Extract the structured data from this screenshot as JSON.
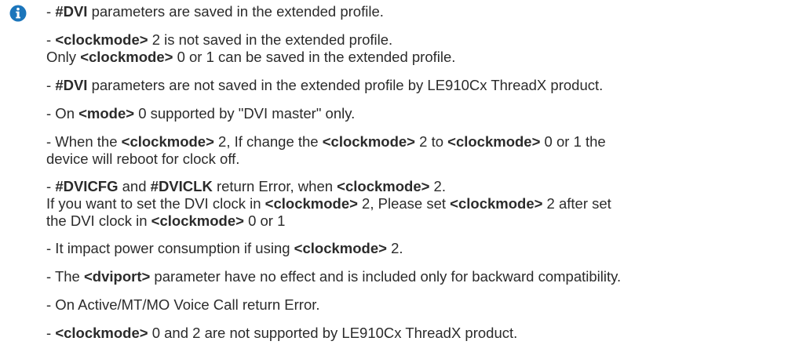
{
  "icon": {
    "name": "info-icon",
    "color": "#1b75bb"
  },
  "notes": [
    {
      "lines": [
        [
          {
            "t": "- "
          },
          {
            "t": "#DVI",
            "b": true
          },
          {
            "t": " parameters are saved in the extended profile."
          }
        ]
      ]
    },
    {
      "lines": [
        [
          {
            "t": "- "
          },
          {
            "t": "<clockmode>",
            "b": true
          },
          {
            "t": " 2 is not saved in the extended profile."
          }
        ],
        [
          {
            "t": "Only "
          },
          {
            "t": "<clockmode>",
            "b": true
          },
          {
            "t": " 0 or 1 can be saved in the extended profile."
          }
        ]
      ]
    },
    {
      "lines": [
        [
          {
            "t": "- "
          },
          {
            "t": "#DVI",
            "b": true
          },
          {
            "t": " parameters are not saved in the extended profile by LE910Cx ThreadX product."
          }
        ]
      ]
    },
    {
      "lines": [
        [
          {
            "t": "- On "
          },
          {
            "t": "<mode>",
            "b": true
          },
          {
            "t": " 0 supported by \"DVI master\" only."
          }
        ]
      ]
    },
    {
      "lines": [
        [
          {
            "t": "- When the "
          },
          {
            "t": "<clockmode>",
            "b": true
          },
          {
            "t": " 2, If change the "
          },
          {
            "t": "<clockmode>",
            "b": true
          },
          {
            "t": " 2 to "
          },
          {
            "t": "<clockmode>",
            "b": true
          },
          {
            "t": " 0 or 1 the"
          }
        ],
        [
          {
            "t": "device will reboot for clock off."
          }
        ]
      ]
    },
    {
      "lines": [
        [
          {
            "t": "- "
          },
          {
            "t": "#DVICFG",
            "b": true
          },
          {
            "t": " and "
          },
          {
            "t": "#DVICLK",
            "b": true
          },
          {
            "t": " return Error, when "
          },
          {
            "t": "<clockmode>",
            "b": true
          },
          {
            "t": " 2."
          }
        ],
        [
          {
            "t": "If you want to set the DVI clock in "
          },
          {
            "t": "<clockmode>",
            "b": true
          },
          {
            "t": " 2, Please set "
          },
          {
            "t": "<clockmode>",
            "b": true
          },
          {
            "t": " 2 after set"
          }
        ],
        [
          {
            "t": "the DVI clock in "
          },
          {
            "t": "<clockmode>",
            "b": true
          },
          {
            "t": " 0 or 1"
          }
        ]
      ]
    },
    {
      "lines": [
        [
          {
            "t": "- It impact power consumption if using "
          },
          {
            "t": "<clockmode>",
            "b": true
          },
          {
            "t": " 2."
          }
        ]
      ]
    },
    {
      "lines": [
        [
          {
            "t": "- The "
          },
          {
            "t": "<dviport>",
            "b": true
          },
          {
            "t": " parameter have no effect and is included only for backward compatibility."
          }
        ]
      ]
    },
    {
      "lines": [
        [
          {
            "t": "- On Active/MT/MO Voice Call return Error."
          }
        ]
      ]
    },
    {
      "lines": [
        [
          {
            "t": "- "
          },
          {
            "t": "<clockmode>",
            "b": true
          },
          {
            "t": " 0 and 2 are not supported by LE910Cx ThreadX product."
          }
        ]
      ]
    }
  ]
}
